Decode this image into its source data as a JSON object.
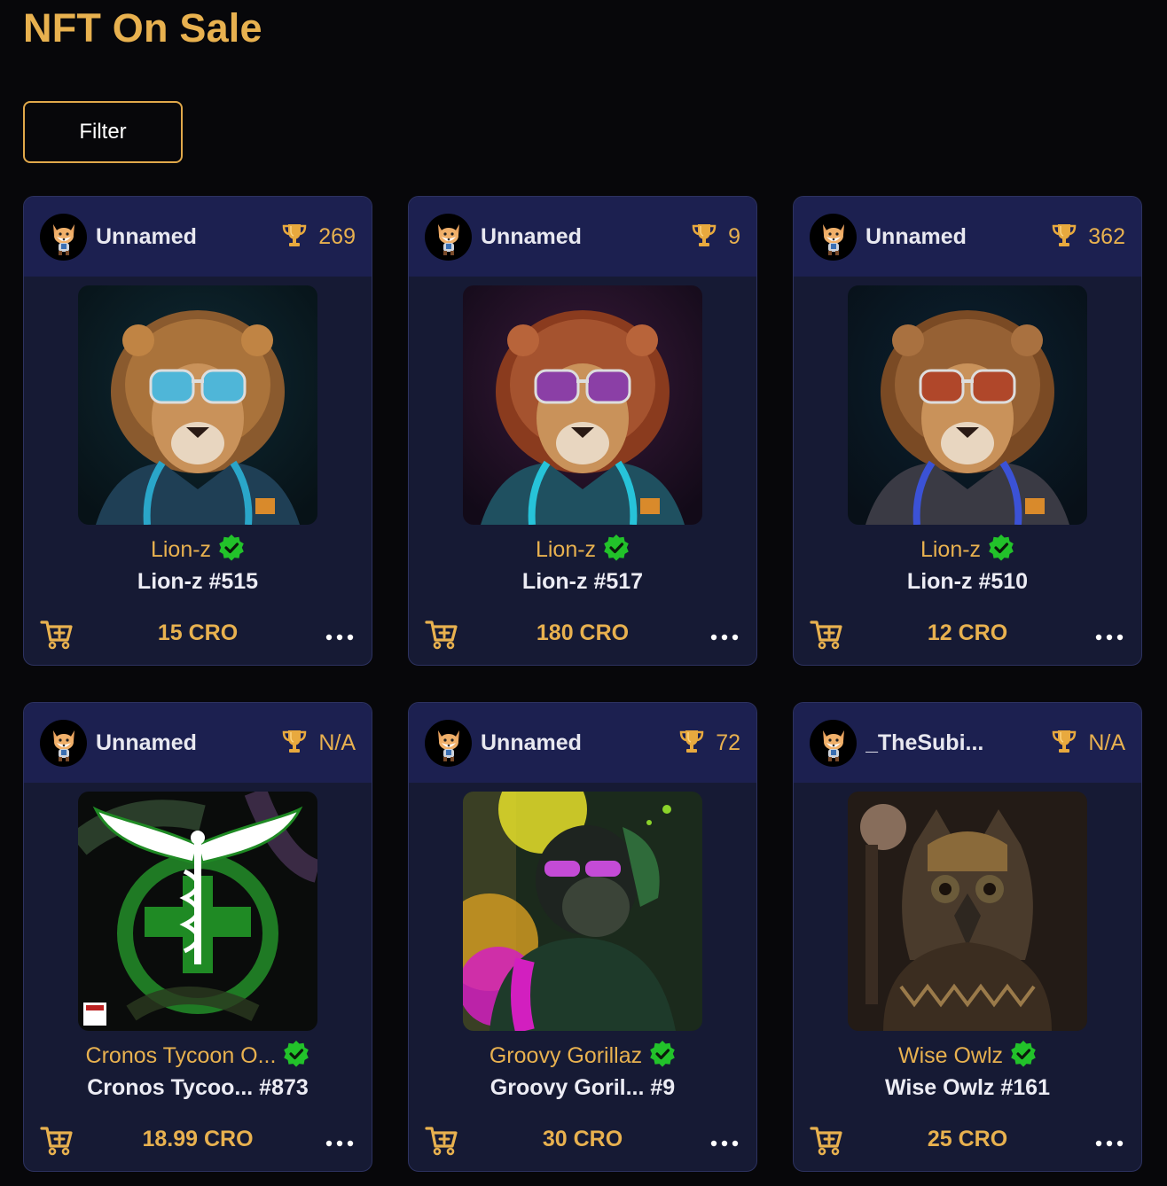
{
  "page": {
    "title": "NFT On Sale",
    "filter_label": "Filter",
    "accent": "#e8b14f",
    "verified_color": "#22c22a"
  },
  "cards": [
    {
      "owner": "Unnamed",
      "rank": "269",
      "collection": "Lion-z",
      "token": "Lion-z #515",
      "price": "15 CRO",
      "art": "lion-blue-shades"
    },
    {
      "owner": "Unnamed",
      "rank": "9",
      "collection": "Lion-z",
      "token": "Lion-z #517",
      "price": "180 CRO",
      "art": "lion-purple-shades"
    },
    {
      "owner": "Unnamed",
      "rank": "362",
      "collection": "Lion-z",
      "token": "Lion-z #510",
      "price": "12 CRO",
      "art": "lion-orange-shades"
    },
    {
      "owner": "Unnamed",
      "rank": "N/A",
      "collection": "Cronos Tycoon O...",
      "token": "Cronos Tycoo... #873",
      "price": "18.99 CRO",
      "art": "caduceus-emblem"
    },
    {
      "owner": "Unnamed",
      "rank": "72",
      "collection": "Groovy Gorillaz",
      "token": "Groovy Goril... #9",
      "price": "30 CRO",
      "art": "gorilla-neon"
    },
    {
      "owner": "_TheSubi...",
      "rank": "N/A",
      "collection": "Wise Owlz",
      "token": "Wise Owlz #161",
      "price": "25 CRO",
      "art": "owl-armor"
    }
  ],
  "icons": {
    "avatar": "fox-avatar-icon",
    "rank": "trophy-icon",
    "verified": "verified-check-icon",
    "cart": "add-to-cart-icon",
    "more": "more-options-icon"
  }
}
